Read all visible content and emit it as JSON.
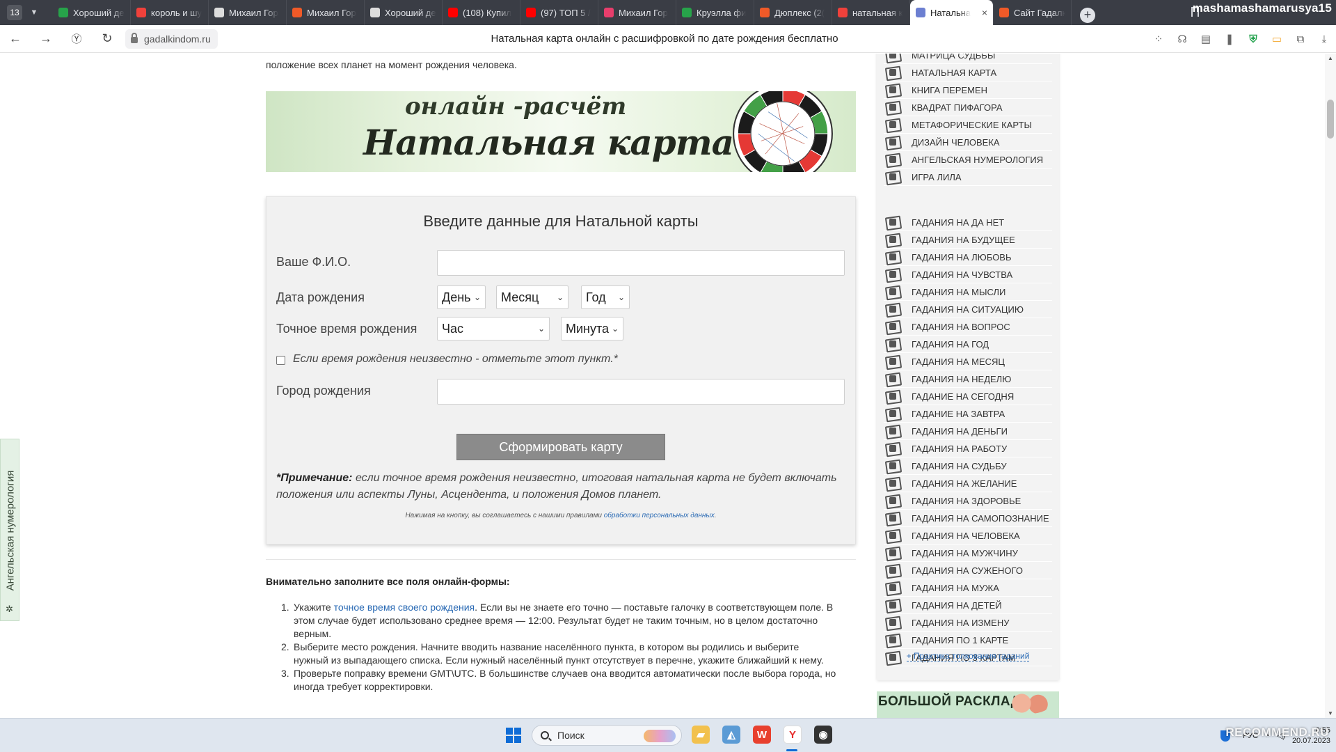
{
  "browser": {
    "tab_count": "13",
    "tabs": [
      {
        "label": "Хороший де",
        "icon": "green-square-icon",
        "color": "#27a34a"
      },
      {
        "label": "король и шу",
        "icon": "yandex-icon",
        "color": "#f0413b"
      },
      {
        "label": "Михаил Гор",
        "icon": "ring-icon",
        "color": "#dddddd"
      },
      {
        "label": "Михаил Гор",
        "icon": "orange-site-icon",
        "color": "#f05a28"
      },
      {
        "label": "Хороший де",
        "icon": "ring-icon",
        "color": "#dddddd"
      },
      {
        "label": "(108) Купил",
        "icon": "youtube-icon",
        "color": "#ff0000"
      },
      {
        "label": "(97) ТОП 5 /",
        "icon": "youtube-icon",
        "color": "#ff0000"
      },
      {
        "label": "Михаил Гор",
        "icon": "pink-circle-icon",
        "color": "#e83e6c"
      },
      {
        "label": "Круэлла фи",
        "icon": "green-square-icon",
        "color": "#27a34a"
      },
      {
        "label": "Дюплекс (2(",
        "icon": "orange-site-icon",
        "color": "#f05a28"
      },
      {
        "label": "натальная к",
        "icon": "yandex-icon",
        "color": "#f0413b"
      },
      {
        "label": "Натальна",
        "icon": "moon-icon",
        "color": "#6c7fd1",
        "active": true
      },
      {
        "label": "Сайт Гадалк",
        "icon": "orange-site-icon",
        "color": "#f05a28"
      }
    ],
    "profile_name": "mashamashamarusya15",
    "url": "gadalkindom.ru",
    "page_title": "Натальная карта онлайн с расшифровкой по дате рождения бесплатно"
  },
  "page": {
    "intro_text": "положение всех планет на момент рождения человека.",
    "banner": {
      "subtitle": "онлайн -расчёт",
      "title": "Натальная карта"
    },
    "form": {
      "heading": "Введите данные для Натальной карты",
      "name_label": "Ваше Ф.И.О.",
      "name_value": "",
      "date_label": "Дата рождения",
      "day_select": "День",
      "month_select": "Месяц",
      "year_select": "Год",
      "time_label": "Точное время рождения",
      "hour_select": "Час",
      "minute_select": "Минута",
      "unknown_time_label": "Если время рождения неизвестно - отметьте этот пункт.*",
      "unknown_time_checked": false,
      "city_label": "Город рождения",
      "city_value": "",
      "submit_label": "Сформировать карту",
      "note_bold": "*Примечание:",
      "note_text": " если точное время рождения неизвестно, итоговая натальная карта не будет включать положения или аспекты Луны, Асцендента, и положения Домов планет.",
      "consent_text": "Нажимая на кнопку, вы соглашаетесь с нашими правилами ",
      "consent_link": "обработки персональных данных",
      "consent_end": "."
    },
    "steps_heading": "Внимательно заполните все поля онлайн-формы:",
    "steps": [
      {
        "num": "1.",
        "before": "Укажите ",
        "link": "точное время своего рождения",
        "after": ". Если вы не знаете его точно — поставьте галочку в соответствующем поле. В этом случае будет использовано среднее время — 12:00. Результат будет не таким точным, но в целом достаточно верным."
      },
      {
        "num": "2.",
        "before": "Выберите место рождения. Начните вводить название населённого пункта, в котором вы родились и выберите нужный из выпадающего списка. Если нужный населённый пункт отсутствует в перечне, укажите ближайший к нему.",
        "link": "",
        "after": ""
      },
      {
        "num": "3.",
        "before": "Проверьте поправку времени GMT\\UTC. В большинстве случаев она вводится автоматически после выбора города, но иногда требует корректировки.",
        "link": "",
        "after": ""
      }
    ]
  },
  "sidebar": {
    "items_top": [
      "МАТРИЦА СУДЬБЫ",
      "НАТАЛЬНАЯ КАРТА",
      "КНИГА ПЕРЕМЕН",
      "КВАДРАТ ПИФАГОРА",
      "МЕТАФОРИЧЕСКИЕ КАРТЫ",
      "ДИЗАЙН ЧЕЛОВЕКА",
      "АНГЕЛЬСКАЯ НУМЕРОЛОГИЯ",
      "ИГРА ЛИЛА"
    ],
    "items_bottom": [
      "ГАДАНИЯ НА ДА НЕТ",
      "ГАДАНИЯ НА БУДУЩЕЕ",
      "ГАДАНИЯ НА ЛЮБОВЬ",
      "ГАДАНИЯ НА ЧУВСТВА",
      "ГАДАНИЯ НА МЫСЛИ",
      "ГАДАНИЯ НА СИТУАЦИЮ",
      "ГАДАНИЯ НА ВОПРОС",
      "ГАДАНИЯ НА ГОД",
      "ГАДАНИЯ НА МЕСЯЦ",
      "ГАДАНИЯ НА НЕДЕЛЮ",
      "ГАДАНИЕ НА СЕГОДНЯ",
      "ГАДАНИЕ НА ЗАВТРА",
      "ГАДАНИЯ НА ДЕНЬГИ",
      "ГАДАНИЯ НА РАБОТУ",
      "ГАДАНИЯ НА СУДЬБУ",
      "ГАДАНИЯ НА ЖЕЛАНИЕ",
      "ГАДАНИЯ НА ЗДОРОВЬЕ",
      "ГАДАНИЯ НА САМОПОЗНАНИЕ",
      "ГАДАНИЯ НА ЧЕЛОВЕКА",
      "ГАДАНИЯ НА МУЖЧИНУ",
      "ГАДАНИЯ НА СУЖЕНОГО",
      "ГАДАНИЯ НА МУЖА",
      "ГАДАНИЯ НА ДЕТЕЙ",
      "ГАДАНИЯ НА ИЗМЕНУ",
      "ГАДАНИЯ ПО 1 КАРТЕ",
      "ГАДАНИЯ ПО 3 КАРТАМ"
    ],
    "more_link": "+ Практика толкования гаданий",
    "banner_text": "БОЛЬШОЙ РАСКЛАД"
  },
  "side_tab": {
    "label": "Ангельская нумерология"
  },
  "taskbar": {
    "search_placeholder": "Поиск",
    "lang": "РУС",
    "time": "0:55",
    "date": "20.07.2023"
  },
  "watermark": "RECOMMEND.RU"
}
